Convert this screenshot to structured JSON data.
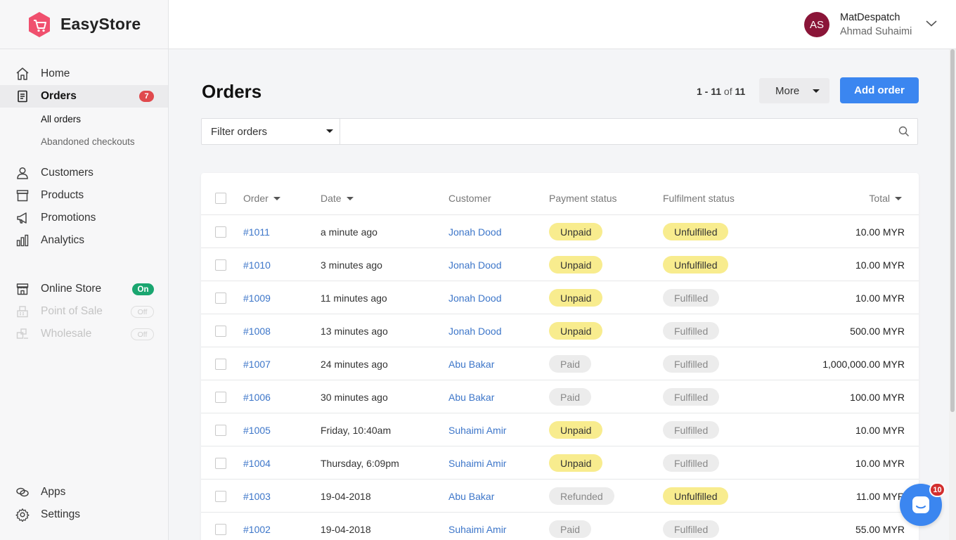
{
  "brand": {
    "name": "EasyStore"
  },
  "user": {
    "initials": "AS",
    "store": "MatDespatch",
    "name": "Ahmad Suhaimi"
  },
  "sidebar": {
    "home": "Home",
    "orders": {
      "label": "Orders",
      "badge": "7"
    },
    "orders_sub": {
      "all": "All orders",
      "abandoned": "Abandoned checkouts"
    },
    "customers": "Customers",
    "products": "Products",
    "promotions": "Promotions",
    "analytics": "Analytics",
    "online_store": {
      "label": "Online Store",
      "status": "On"
    },
    "pos": {
      "label": "Point of Sale",
      "status": "Off"
    },
    "wholesale": {
      "label": "Wholesale",
      "status": "Off"
    },
    "apps": "Apps",
    "settings": "Settings"
  },
  "page": {
    "title": "Orders",
    "pagination": {
      "range": "1 - 11",
      "of": "of",
      "total": "11"
    },
    "more_label": "More",
    "add_label": "Add order",
    "filter_label": "Filter orders",
    "search_placeholder": ""
  },
  "table": {
    "headers": {
      "order": "Order",
      "date": "Date",
      "customer": "Customer",
      "payment": "Payment status",
      "fulfilment": "Fulfilment status",
      "total": "Total"
    },
    "rows": [
      {
        "order": "#1011",
        "date": "a minute ago",
        "customer": "Jonah Dood",
        "payment": "Unpaid",
        "fulfilment": "Unfulfilled",
        "total": "10.00 MYR"
      },
      {
        "order": "#1010",
        "date": "3 minutes ago",
        "customer": "Jonah Dood",
        "payment": "Unpaid",
        "fulfilment": "Unfulfilled",
        "total": "10.00 MYR"
      },
      {
        "order": "#1009",
        "date": "11 minutes ago",
        "customer": "Jonah Dood",
        "payment": "Unpaid",
        "fulfilment": "Fulfilled",
        "total": "10.00 MYR"
      },
      {
        "order": "#1008",
        "date": "13 minutes ago",
        "customer": "Jonah Dood",
        "payment": "Unpaid",
        "fulfilment": "Fulfilled",
        "total": "500.00 MYR"
      },
      {
        "order": "#1007",
        "date": "24 minutes ago",
        "customer": "Abu Bakar",
        "payment": "Paid",
        "fulfilment": "Fulfilled",
        "total": "1,000,000.00 MYR"
      },
      {
        "order": "#1006",
        "date": "30 minutes ago",
        "customer": "Abu Bakar",
        "payment": "Paid",
        "fulfilment": "Fulfilled",
        "total": "100.00 MYR"
      },
      {
        "order": "#1005",
        "date": "Friday, 10:40am",
        "customer": "Suhaimi Amir",
        "payment": "Unpaid",
        "fulfilment": "Fulfilled",
        "total": "10.00 MYR"
      },
      {
        "order": "#1004",
        "date": "Thursday, 6:09pm",
        "customer": "Suhaimi Amir",
        "payment": "Unpaid",
        "fulfilment": "Fulfilled",
        "total": "10.00 MYR"
      },
      {
        "order": "#1003",
        "date": "19-04-2018",
        "customer": "Abu Bakar",
        "payment": "Refunded",
        "fulfilment": "Unfulfilled",
        "total": "11.00 MYR"
      },
      {
        "order": "#1002",
        "date": "19-04-2018",
        "customer": "Suhaimi Amir",
        "payment": "Paid",
        "fulfilment": "Fulfilled",
        "total": "55.00 MYR"
      }
    ]
  },
  "chat": {
    "badge": "10"
  },
  "colors": {
    "accent": "#3b86f0",
    "unpaid": "#f8ec8e",
    "neutral_tag": "#ececec",
    "link": "#3d76c9",
    "on": "#1aa670",
    "badge": "#e0494d",
    "avatar": "#8a1538",
    "logo": "#f0506e"
  },
  "icons": [
    "logo-cart-icon",
    "home-icon",
    "orders-icon",
    "customers-icon",
    "products-icon",
    "promotions-icon",
    "analytics-icon",
    "online-store-icon",
    "point-of-sale-icon",
    "wholesale-icon",
    "apps-icon",
    "settings-icon",
    "search-icon",
    "chevron-down-icon",
    "chat-icon"
  ]
}
